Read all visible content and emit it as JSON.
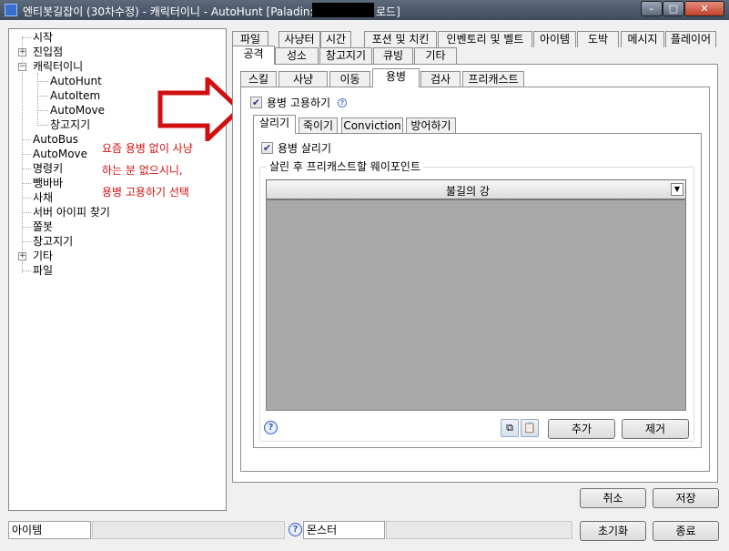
{
  "window": {
    "title": "엔티봇길잡이 (30차수정) - 캐릭터이니 - AutoHunt [Paladin:",
    "title_suffix": "로드]",
    "min_glyph": "–",
    "max_glyph": "□",
    "close_glyph": "✕"
  },
  "tree": {
    "items": [
      {
        "label": "시작"
      },
      {
        "label": "진입점"
      },
      {
        "label": "캐릭터이니"
      },
      {
        "label": "AutoHunt"
      },
      {
        "label": "AutoItem"
      },
      {
        "label": "AutoMove"
      },
      {
        "label": "창고지기"
      },
      {
        "label": "AutoBus"
      },
      {
        "label": "AutoMove"
      },
      {
        "label": "명령키"
      },
      {
        "label": "뺑바바"
      },
      {
        "label": "사채"
      },
      {
        "label": "서버 아이피 찾기"
      },
      {
        "label": "쫄봇"
      },
      {
        "label": "창고지기"
      },
      {
        "label": "기타"
      },
      {
        "label": "파일"
      }
    ],
    "expander_plus": "+",
    "expander_minus": "−"
  },
  "annotation": {
    "lines": [
      "요즘 용병 없이 사냥",
      "하는 분 없으시니,",
      "용병 고용하기 선택"
    ],
    "color": "#d01010"
  },
  "top_tabs_row1": [
    "파일",
    "사냥터",
    "시간",
    "포션 및 치킨",
    "인벤토리 및 벨트",
    "아이템",
    "도박",
    "메시지",
    "플레이어"
  ],
  "top_tabs_row2": [
    "공격",
    "성소",
    "창고지기",
    "큐빙",
    "기타"
  ],
  "sub_tabs": [
    "스킬",
    "사냥",
    "이동",
    "용병",
    "검사",
    "프리캐스트"
  ],
  "merc": {
    "hire_checked": true,
    "hire_label": "용병 고용하기",
    "inner_tabs": [
      "살리기",
      "죽이기",
      "Conviction",
      "방어하기"
    ],
    "revive_checked": true,
    "revive_label": "용병 살리기",
    "group_title": "살린 후 프리캐스트할 웨이포인트",
    "waypoint_selected": "불길의 강",
    "help_glyph": "?",
    "copy_icon": "⧉",
    "paste_icon": "📋",
    "add_button": "추가",
    "remove_button": "제거"
  },
  "footer": {
    "cancel": "취소",
    "save": "저장",
    "reset": "초기화",
    "exit": "종료"
  },
  "status": {
    "item_label": "아이템",
    "monster_label": "몬스터"
  },
  "colors": {
    "title_bar": "#4b586a",
    "close_button": "#c0412a",
    "list_background": "#a9a9a9",
    "annotation": "#d01010"
  }
}
